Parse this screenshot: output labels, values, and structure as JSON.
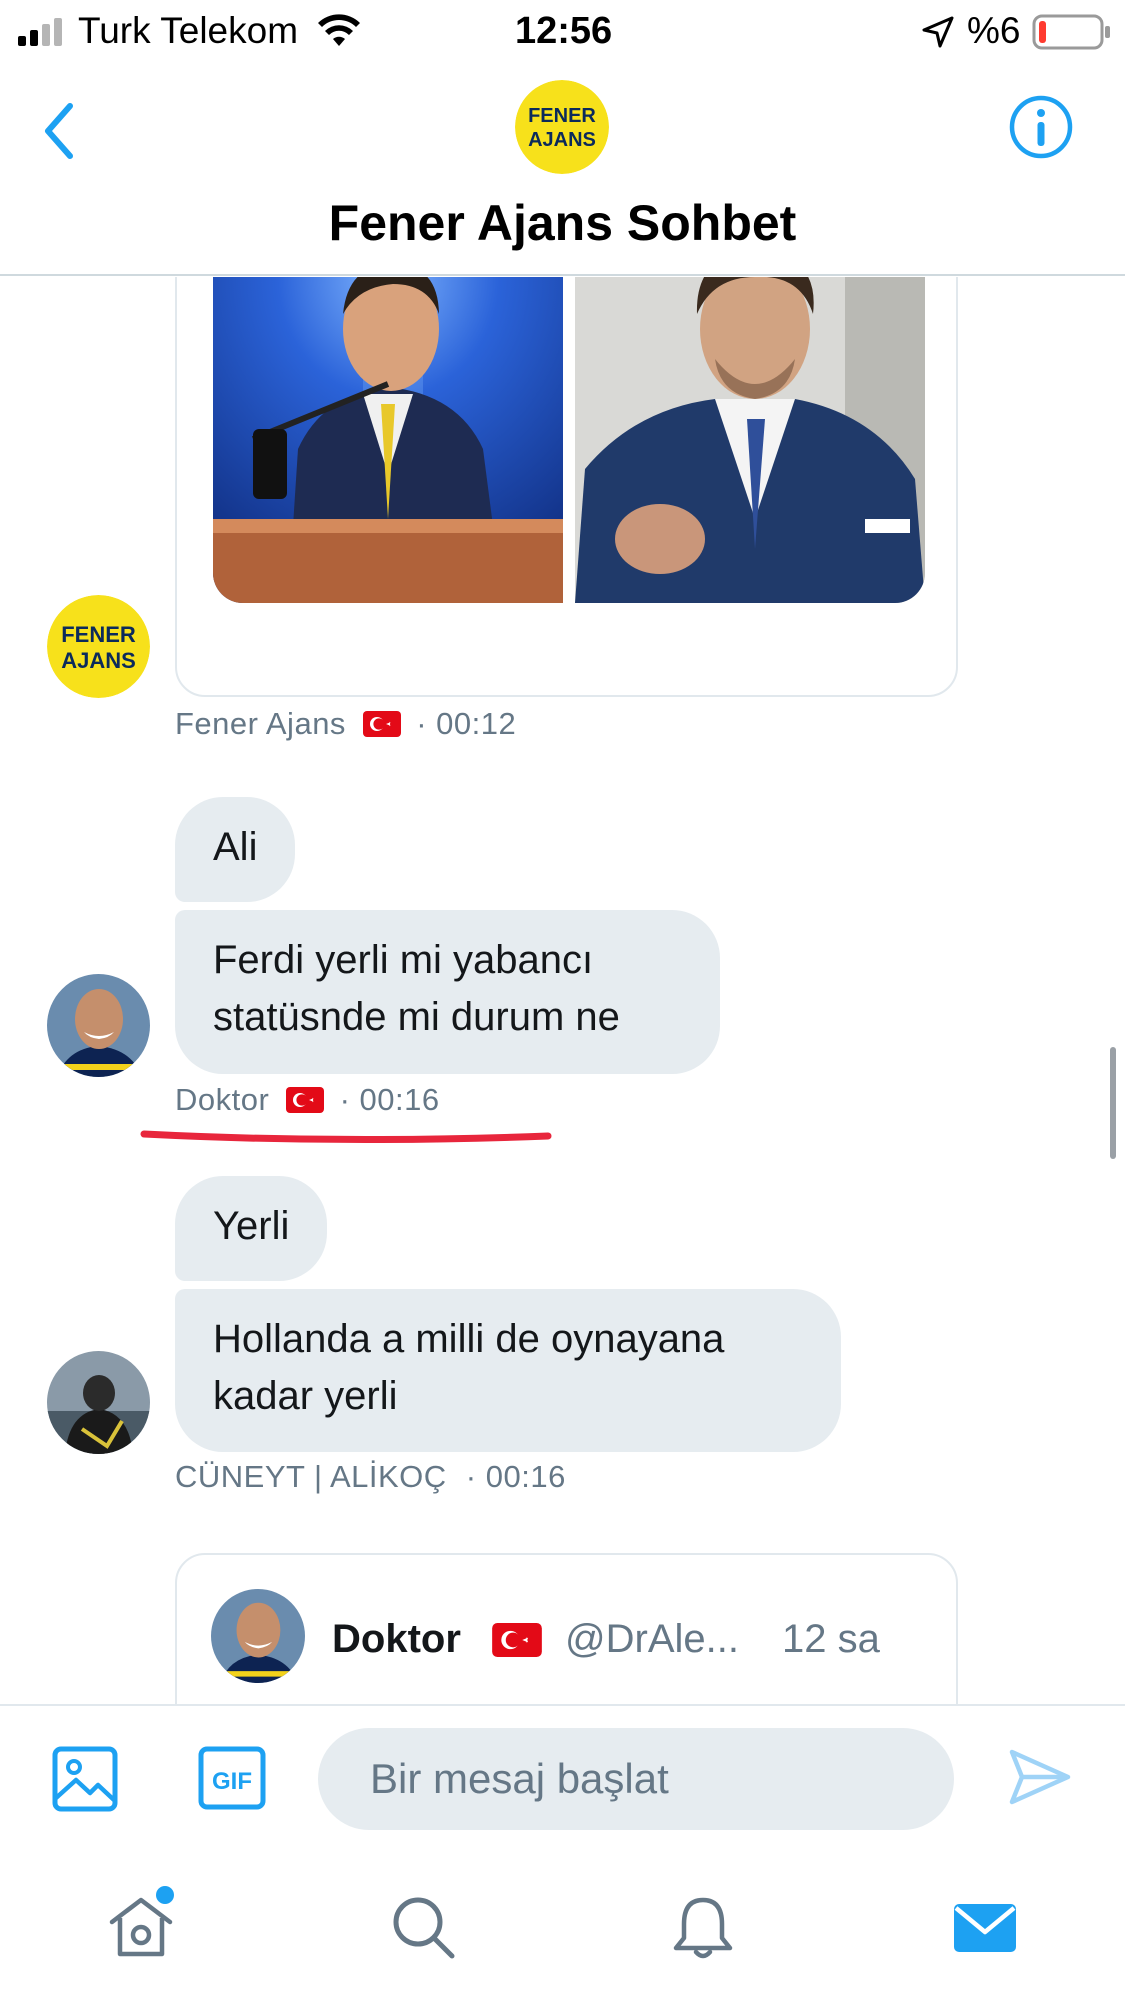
{
  "status_bar": {
    "carrier": "Turk Telekom",
    "time": "12:56",
    "battery_percent": "%6",
    "battery_level": 0.06
  },
  "header": {
    "title": "Fener Ajans Sohbet",
    "avatar_text_line1": "FENER",
    "avatar_text_line2": "AJANS"
  },
  "messages": [
    {
      "sender": "Fener Ajans",
      "time": "· 00:12",
      "type": "media"
    },
    {
      "sender": "Doktor",
      "time": "· 00:16",
      "bubbles": [
        "Ali",
        "Ferdi yerli mi yabancı statüsnde mi durum ne"
      ],
      "bubble_lines": [
        [
          "Ali"
        ],
        [
          "Ferdi yerli mi yabancı",
          "statüsnde mi durum ne"
        ]
      ]
    },
    {
      "sender": "CÜNEYT | ALİKOÇ",
      "time": "· 00:16",
      "bubbles": [
        "Yerli",
        "Hollanda a milli de oynayana kadar yerli"
      ],
      "bubble_lines": [
        [
          "Yerli"
        ],
        [
          "Hollanda a milli de oynayana",
          "kadar yerli"
        ]
      ]
    }
  ],
  "quoted_tweet": {
    "name": "Doktor",
    "handle": "@DrAle...",
    "time": "12 sa"
  },
  "composer": {
    "placeholder": "Bir mesaj başlat",
    "gif_label": "GIF"
  },
  "tabbar": {
    "items": [
      "home",
      "search",
      "notifications",
      "messages"
    ],
    "active": "messages"
  },
  "colors": {
    "accent": "#1da1f2",
    "bubble": "#e6ecf0",
    "meta_text": "#657786",
    "underline": "#e8263c"
  },
  "icons": {
    "back": "chevron-left-icon",
    "info": "info-icon",
    "image": "image-icon",
    "gif": "gif-icon",
    "send": "send-icon",
    "home": "home-icon",
    "search": "search-icon",
    "notifications": "bell-icon",
    "messages": "envelope-icon"
  }
}
